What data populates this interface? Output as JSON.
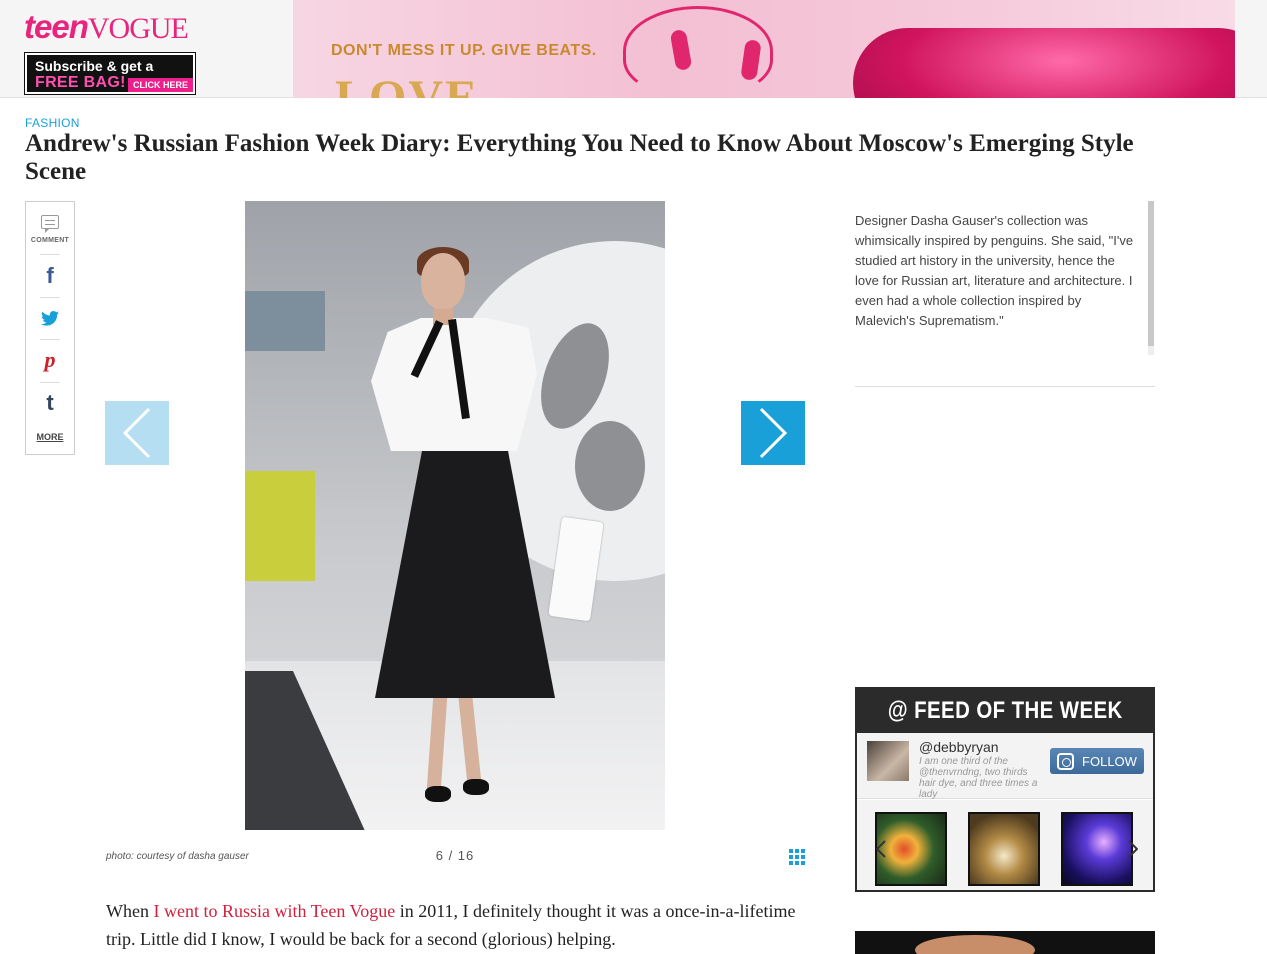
{
  "header": {
    "logo_teen": "teen",
    "logo_vogue": "VOGUE",
    "subscribe_line1": "Subscribe & get a",
    "subscribe_line2": "FREE BAG!",
    "subscribe_cta": "CLICK HERE",
    "ad_text": "DON'T MESS IT UP. GIVE BEATS.",
    "ad_love": "LOVE"
  },
  "article": {
    "category": "FASHION",
    "title": "Andrew's Russian Fashion Week Diary: Everything You Need to Know About Moscow's Emerging Style Scene",
    "body_link": "I went to Russia with Teen Vogue",
    "body_before": "When ",
    "body_after": " in 2011, I definitely thought it was a once-in-a-lifetime trip. Little did I know, I would be back for a second (glorious) helping."
  },
  "share": {
    "comment_label": "COMMENT",
    "more_label": "MORE",
    "facebook_glyph": "f",
    "pinterest_glyph": "p",
    "tumblr_glyph": "t"
  },
  "slideshow": {
    "photo_credit": "photo: courtesy of dasha gauser",
    "counter": "6 / 16",
    "current": 6,
    "total": 16
  },
  "caption": {
    "text": "Designer Dasha Gauser's collection was whimsically inspired by penguins. She said, \"I've studied art history in the university, hence the love for Russian art, literature and architecture. I even had a whole collection inspired by Malevich's Suprematism.\""
  },
  "feed": {
    "title": "@ FEED OF THE WEEK",
    "handle": "@debbyryan",
    "bio": "I am one third of the @thenvrndng, two thirds hair dye, and three times a lady",
    "follow_label": "FOLLOW"
  },
  "colors": {
    "brand_pink": "#e8247c",
    "accent_blue": "#1aa0d8",
    "link_red": "#d0213e"
  }
}
